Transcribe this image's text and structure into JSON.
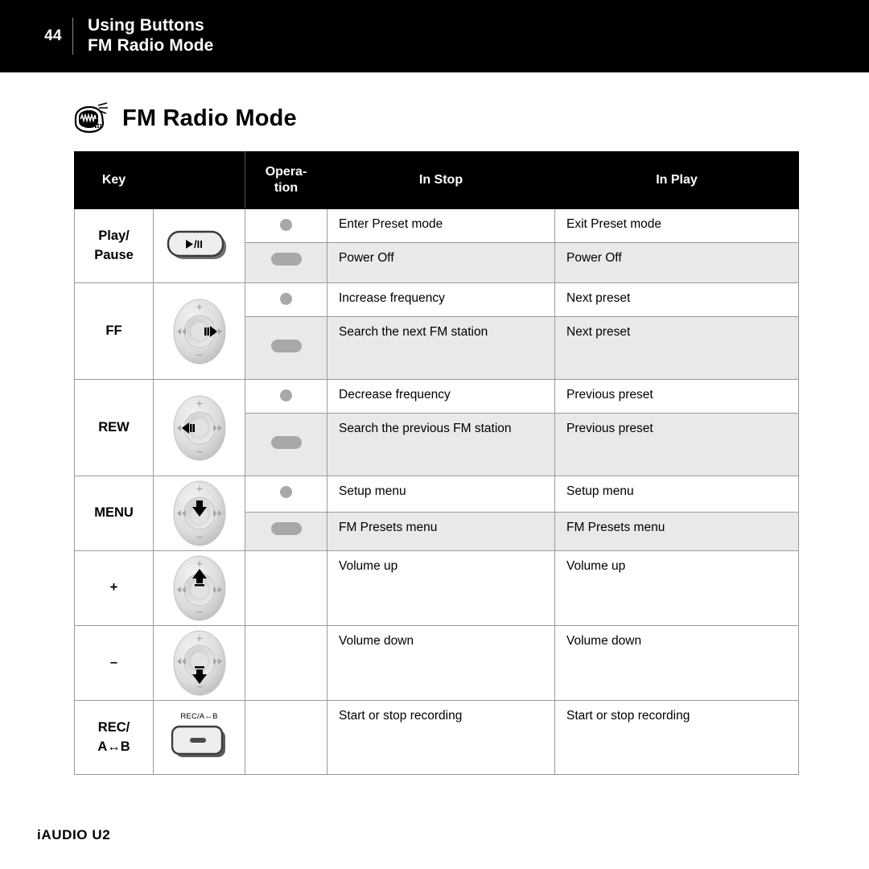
{
  "header": {
    "page_number": "44",
    "line1": "Using Buttons",
    "line2": "FM Radio Mode"
  },
  "section": {
    "icon": "fm-radio-icon",
    "title": "FM Radio Mode"
  },
  "table": {
    "columns": [
      "Key",
      "",
      "Opera-\ntion",
      "In Stop",
      "In Play"
    ],
    "headers": {
      "key": "Key",
      "blank": "",
      "operation_line1": "Opera-",
      "operation_line2": "tion",
      "in_stop": "In Stop",
      "in_play": "In Play"
    },
    "rows": [
      {
        "key": "Play/\nPause",
        "key_line1": "Play/",
        "key_line2": "Pause",
        "button_icon": "play-pause-button-icon",
        "button_label": "▶/II",
        "operations": [
          {
            "indicator": "short-press-dot",
            "in_stop": "Enter Preset mode",
            "in_play": "Exit Preset mode",
            "shaded": false
          },
          {
            "indicator": "long-press-pill",
            "in_stop": "Power Off",
            "in_play": "Power Off",
            "shaded": true
          }
        ]
      },
      {
        "key": "FF",
        "key_line1": "FF",
        "key_line2": "",
        "button_icon": "joystick-right-icon",
        "button_label": "",
        "operations": [
          {
            "indicator": "short-press-dot",
            "in_stop": "Increase frequency",
            "in_play": "Next preset",
            "shaded": false
          },
          {
            "indicator": "long-press-pill",
            "in_stop": "Search the next FM station",
            "in_play": "Next preset",
            "shaded": true
          }
        ]
      },
      {
        "key": "REW",
        "key_line1": "REW",
        "key_line2": "",
        "button_icon": "joystick-left-icon",
        "button_label": "",
        "operations": [
          {
            "indicator": "short-press-dot",
            "in_stop": "Decrease frequency",
            "in_play": "Previous preset",
            "shaded": false
          },
          {
            "indicator": "long-press-pill",
            "in_stop": "Search the previous FM station",
            "in_play": "Previous preset",
            "shaded": true
          }
        ]
      },
      {
        "key": "MENU",
        "key_line1": "MENU",
        "key_line2": "",
        "button_icon": "joystick-down-press-icon",
        "button_label": "",
        "operations": [
          {
            "indicator": "short-press-dot",
            "in_stop": "Setup menu",
            "in_play": "Setup menu",
            "shaded": false
          },
          {
            "indicator": "long-press-pill",
            "in_stop": "FM Presets menu",
            "in_play": "FM Presets menu",
            "shaded": true
          }
        ]
      },
      {
        "key": "+",
        "key_line1": "+",
        "key_line2": "",
        "button_icon": "joystick-up-icon",
        "button_label": "",
        "operations": [
          {
            "indicator": "none",
            "in_stop": "Volume up",
            "in_play": "Volume up",
            "shaded": false
          }
        ]
      },
      {
        "key": "–",
        "key_line1": "–",
        "key_line2": "",
        "button_icon": "joystick-down-icon",
        "button_label": "",
        "operations": [
          {
            "indicator": "none",
            "in_stop": "Volume down",
            "in_play": "Volume down",
            "shaded": false
          }
        ]
      },
      {
        "key": "REC/\nA↔B",
        "key_line1": "REC/",
        "key_line2": "A↔B",
        "button_icon": "rec-ab-button-icon",
        "button_label": "REC/A↔B",
        "operations": [
          {
            "indicator": "none",
            "in_stop": "Start or stop recording",
            "in_play": "Start or stop recording",
            "shaded": false
          }
        ]
      }
    ]
  },
  "footer": {
    "product": "iAUDIO U2"
  },
  "colors": {
    "header_band": "#000000",
    "table_header": "#000000",
    "shaded_row": "#e9e9e9",
    "border": "#9a9a9a",
    "indicator": "#a8a8a8",
    "text": "#000000"
  }
}
